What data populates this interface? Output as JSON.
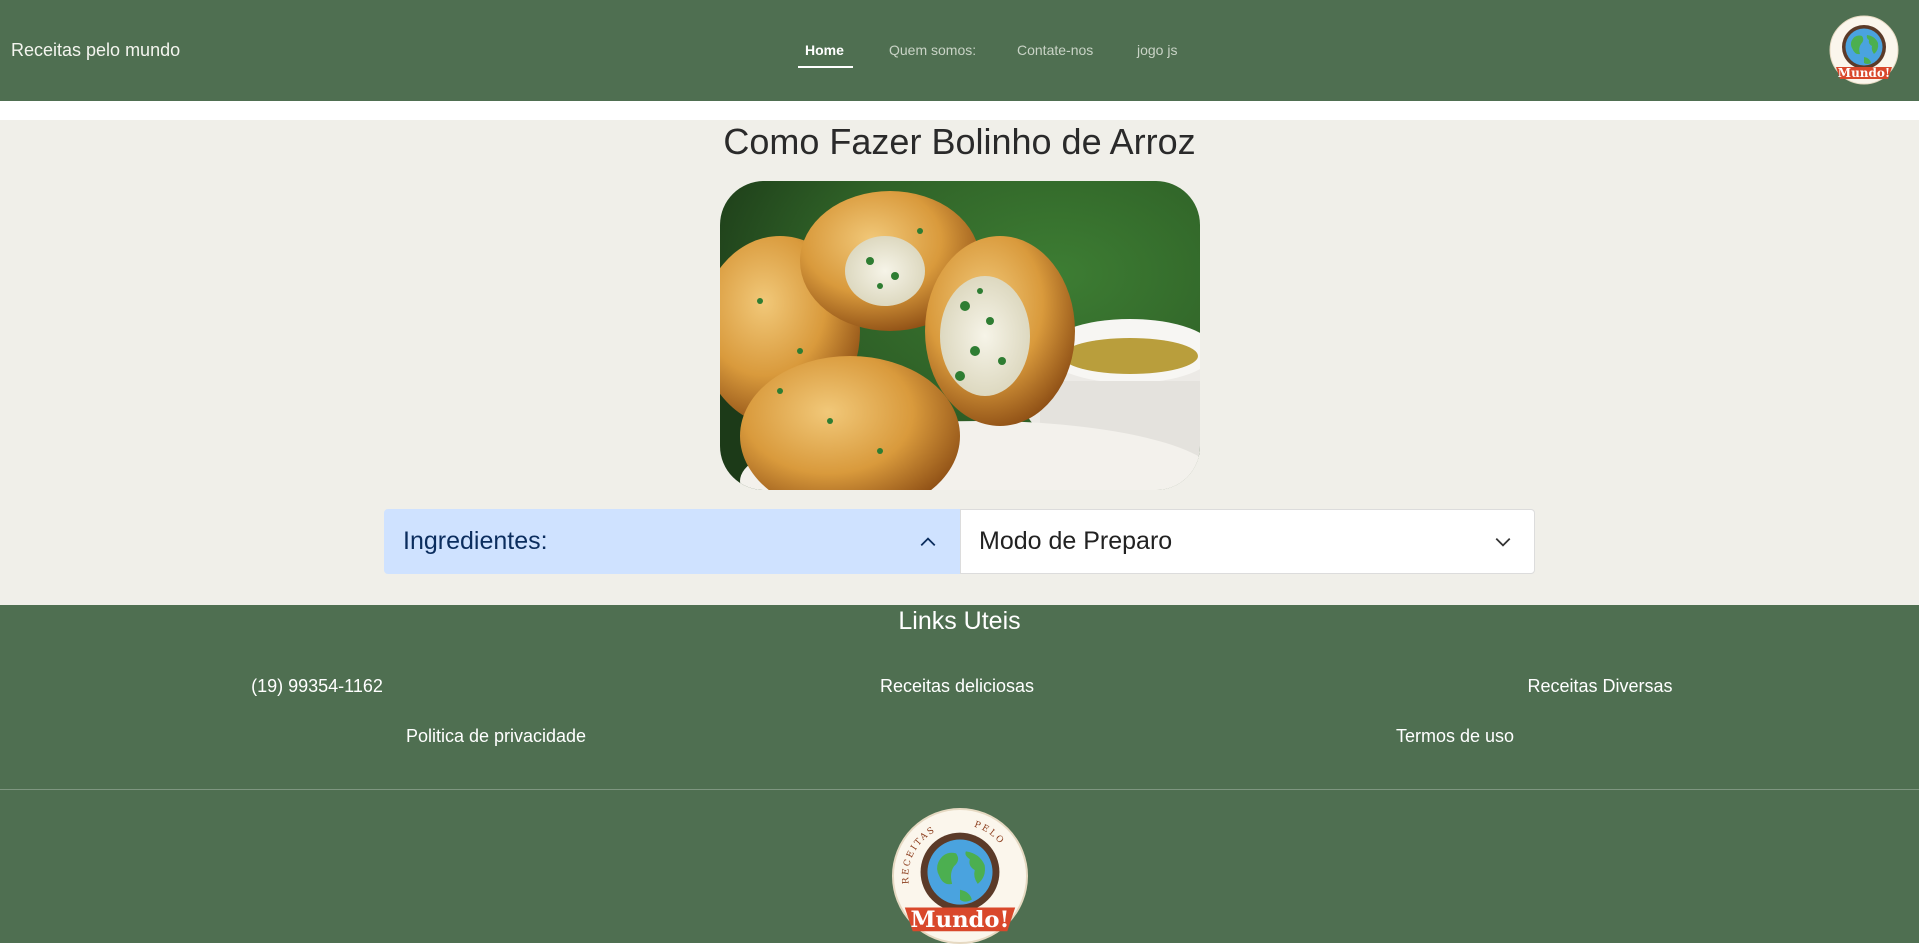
{
  "navbar": {
    "brand": "Receitas pelo mundo",
    "links": [
      {
        "label": "Home",
        "active": true
      },
      {
        "label": "Quem somos:"
      },
      {
        "label": "Contate-nos"
      },
      {
        "label": "jogo js"
      }
    ],
    "logo_text": "Mundo!"
  },
  "main": {
    "title": "Como Fazer Bolinho de Arroz",
    "accordion": [
      {
        "label": "Ingredientes:",
        "expanded": true,
        "icon": "chevron-up-icon"
      },
      {
        "label": "Modo de Preparo",
        "expanded": false,
        "icon": "chevron-down-icon"
      }
    ]
  },
  "footer": {
    "title": "Links Uteis",
    "links": [
      {
        "label": "(19) 99354-1162"
      },
      {
        "label": "Receitas deliciosas"
      },
      {
        "label": "Receitas Diversas"
      },
      {
        "label": "Politica de privacidade"
      },
      {
        "label": "Termos de uso"
      }
    ],
    "logo_text": "Mundo!",
    "logo_arc_left": "RECEITAS",
    "logo_arc_right": "PELO"
  },
  "colors": {
    "navbar": "#4f6f51",
    "main_bg": "#f0efe9",
    "accordion_open": "#cfe2ff",
    "logo_ribbon": "#d9482b"
  }
}
